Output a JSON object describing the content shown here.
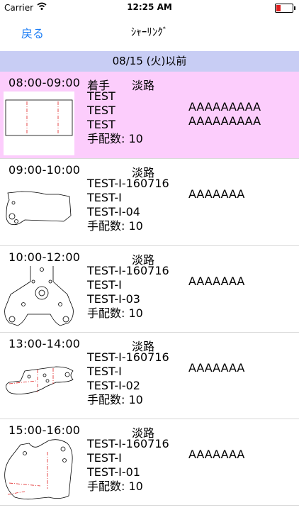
{
  "status_bar": {
    "carrier": "Carrier",
    "time": "12:25 AM"
  },
  "nav": {
    "back_label": "戻る",
    "title": "ｼｬｰﾘﾝｸﾞ"
  },
  "section_header": "08/15 (火)以前",
  "rows": [
    {
      "time": "08:00-09:00",
      "status": "着手",
      "place": "淡路",
      "line1": "TEST",
      "line2": "TEST",
      "line3": "TEST",
      "line4": "手配数: 10",
      "right1": "AAAAAAAAA",
      "right2": "AAAAAAAAA",
      "highlighted": true
    },
    {
      "time": "09:00-10:00",
      "status": "",
      "place": "淡路",
      "line1": "TEST-I-160716",
      "line2": "TEST-I",
      "line3": "TEST-I-04",
      "line4": "手配数: 10",
      "right1": "AAAAAAA",
      "right2": ""
    },
    {
      "time": "10:00-12:00",
      "status": "",
      "place": "淡路",
      "line1": "TEST-I-160716",
      "line2": "TEST-I",
      "line3": "TEST-I-03",
      "line4": "手配数: 10",
      "right1": "AAAAAAA",
      "right2": ""
    },
    {
      "time": "13:00-14:00",
      "status": "",
      "place": "淡路",
      "line1": "TEST-I-160716",
      "line2": "TEST-I",
      "line3": "TEST-I-02",
      "line4": "手配数: 10",
      "right1": "AAAAAAA",
      "right2": ""
    },
    {
      "time": "15:00-16:00",
      "status": "",
      "place": "淡路",
      "line1": "TEST-I-160716",
      "line2": "TEST-I",
      "line3": "TEST-I-01",
      "line4": "手配数: 10",
      "right1": "AAAAAAA",
      "right2": ""
    }
  ],
  "colors": {
    "accent": "#1a7cf5",
    "section_bg": "#c8cdf4",
    "highlight_bg": "#fccdfc",
    "cut_line": "#e02020"
  }
}
